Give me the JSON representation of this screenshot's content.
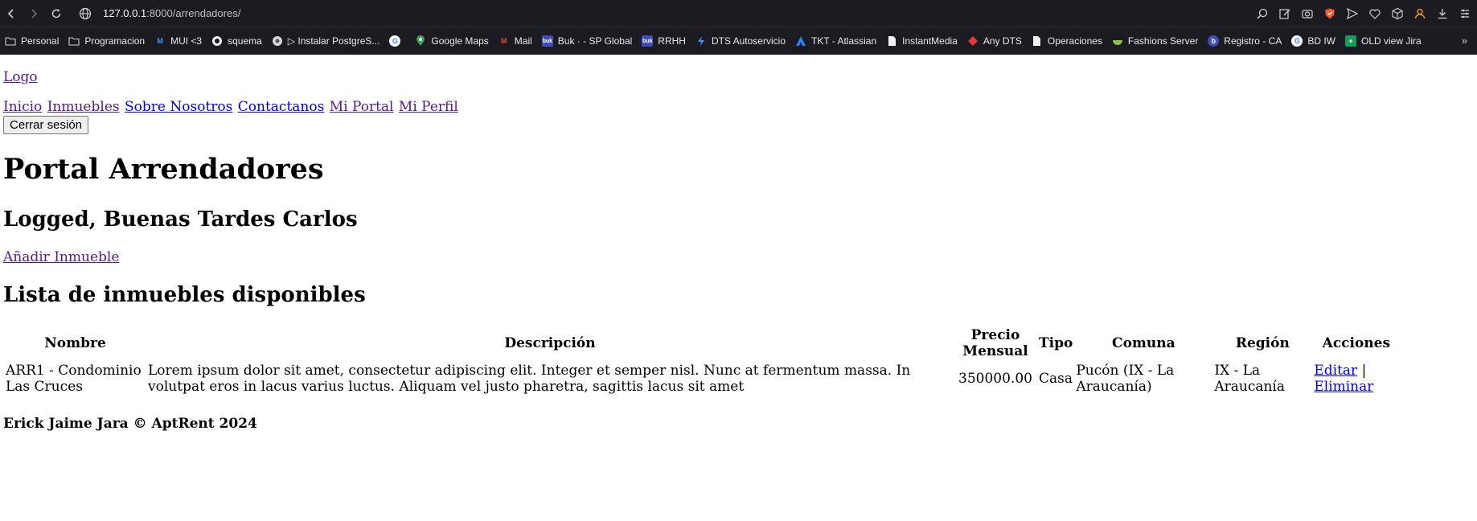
{
  "browser": {
    "url_host": "127.0.0.1",
    "url_path": ":8000/arrendadores/",
    "bookmarks": [
      {
        "label": "Personal",
        "icon": "folder-icon"
      },
      {
        "label": "Programacion",
        "icon": "folder-icon"
      },
      {
        "label": "MUI <3",
        "icon": "mui-icon"
      },
      {
        "label": "squema",
        "icon": "github-icon"
      },
      {
        "label": "▷ Instalar PostgreS...",
        "icon": "globe-icon"
      },
      {
        "label": "",
        "icon": "google-icon"
      },
      {
        "label": "Google Maps",
        "icon": "maps-icon"
      },
      {
        "label": "Mail",
        "icon": "gmail-icon"
      },
      {
        "label": "Buk · - SP Global",
        "icon": "buk-icon"
      },
      {
        "label": "RRHH",
        "icon": "buk-icon"
      },
      {
        "label": "DTS Autoservicio",
        "icon": "bolt-icon"
      },
      {
        "label": "TKT - Atlassian",
        "icon": "atlassian-icon"
      },
      {
        "label": "InstantMedia",
        "icon": "page-icon"
      },
      {
        "label": "Any DTS",
        "icon": "diamond-icon"
      },
      {
        "label": "Operaciones",
        "icon": "page-icon"
      },
      {
        "label": "Fashions Server",
        "icon": "bowl-icon"
      },
      {
        "label": "Registro - CA",
        "icon": "b-icon"
      },
      {
        "label": "BD IW",
        "icon": "google-icon"
      },
      {
        "label": "OLD view Jira",
        "icon": "plus-icon"
      }
    ]
  },
  "site": {
    "logo": "Logo",
    "nav": [
      "Inicio",
      "Inmuebles",
      "Sobre Nosotros",
      "Contactanos",
      "Mi Portal",
      "Mi Perfil"
    ],
    "logout": "Cerrar sesión"
  },
  "main": {
    "title": "Portal Arrendadores",
    "greeting": "Logged, Buenas Tardes Carlos",
    "add_link": "Añadir Inmueble",
    "list_title": "Lista de inmuebles disponibles",
    "table": {
      "headers": [
        "Nombre",
        "Descripción",
        "Precio Mensual",
        "Tipo",
        "Comuna",
        "Región",
        "Acciones"
      ],
      "rows": [
        {
          "nombre": "ARR1 - Condominio Las Cruces",
          "descripcion": "Lorem ipsum dolor sit amet, consectetur adipiscing elit. Integer et semper nisl. Nunc at fermentum massa. In volutpat eros in lacus varius luctus. Aliquam vel justo pharetra, sagittis lacus sit amet",
          "precio": "350000.00",
          "tipo": "Casa",
          "comuna": "Pucón (IX - La Araucanía)",
          "region": "IX - La Araucanía",
          "edit": "Editar",
          "separator": "|",
          "delete": "Eliminar"
        }
      ]
    }
  },
  "footer": "Erick Jaime Jara © AptRent 2024"
}
